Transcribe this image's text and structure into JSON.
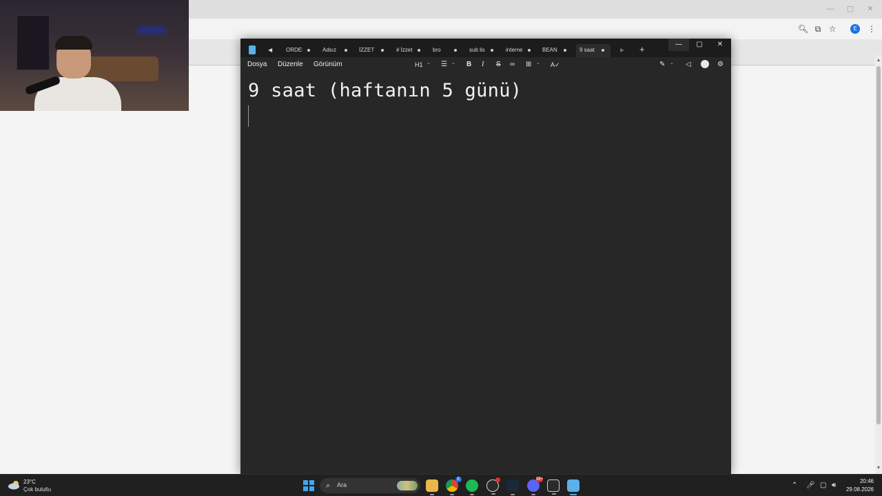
{
  "browser": {
    "window_controls": [
      "—",
      "▢",
      "✕"
    ],
    "toolbar_icons": [
      "zoom-icon",
      "install-icon",
      "star-icon",
      "profile-avatar",
      "menu-icon"
    ],
    "profile_initial": "E"
  },
  "notepad": {
    "tabs": [
      {
        "label": "ORDEI",
        "active": false
      },
      {
        "label": "Adsız",
        "active": false
      },
      {
        "label": "İZZET I",
        "active": false
      },
      {
        "label": "# İzzet",
        "active": false
      },
      {
        "label": "bro",
        "active": false
      },
      {
        "label": "sub lis",
        "active": false
      },
      {
        "label": "interne",
        "active": false
      },
      {
        "label": "BEAN I",
        "active": false
      },
      {
        "label": "9 saat",
        "active": true
      }
    ],
    "new_tab": "+",
    "window_controls": {
      "minimize": "—",
      "maximize": "▢",
      "close": "✕"
    },
    "menu": {
      "file": "Dosya",
      "edit": "Düzenle",
      "view": "Görünüm"
    },
    "toolbar": {
      "heading": "H1",
      "heading_chevron": "⌄",
      "list_chevron": "⌄",
      "table_chevron": "⌄",
      "copilot_chevron": "⌄",
      "bold": "B",
      "italic": "I",
      "strike": "S"
    },
    "editor": {
      "heading_text": "9 saat (haftanın 5 günü)"
    }
  },
  "taskbar": {
    "weather": {
      "temp": "23°C",
      "desc": "Çok bulutlu"
    },
    "search_placeholder": "Ara",
    "apps": [
      {
        "name": "file-explorer",
        "badge": ""
      },
      {
        "name": "chrome",
        "badge": "E"
      },
      {
        "name": "spotify",
        "badge": ""
      },
      {
        "name": "steam-friends",
        "badge": ""
      },
      {
        "name": "steam",
        "badge": ""
      },
      {
        "name": "discord",
        "badge": "99+"
      },
      {
        "name": "remote",
        "badge": ""
      },
      {
        "name": "notepad",
        "badge": ""
      }
    ],
    "clock": {
      "time": "20:46",
      "date": "29.08.2026"
    }
  },
  "colors": {
    "accent": "#5aa9e8",
    "notepad_bg": "#272727",
    "taskbar_bg": "#202020",
    "discord": "#5865f2",
    "spotify": "#1db954"
  }
}
